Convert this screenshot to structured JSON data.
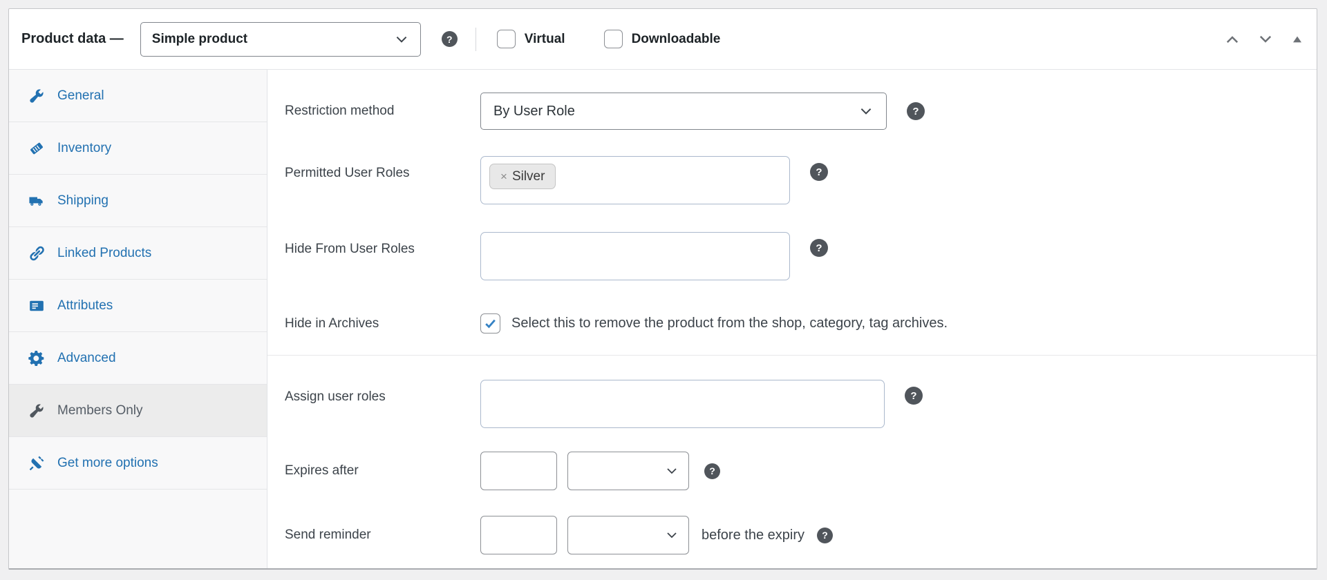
{
  "header": {
    "title": "Product data —",
    "product_type": "Simple product",
    "virtual_label": "Virtual",
    "downloadable_label": "Downloadable"
  },
  "sidebar": {
    "active_item": "Members Only",
    "items": [
      {
        "label": "General",
        "icon": "wrench-icon"
      },
      {
        "label": "Inventory",
        "icon": "tag-icon"
      },
      {
        "label": "Shipping",
        "icon": "truck-icon"
      },
      {
        "label": "Linked Products",
        "icon": "link-icon"
      },
      {
        "label": "Attributes",
        "icon": "list-card-icon"
      },
      {
        "label": "Advanced",
        "icon": "gear-icon"
      },
      {
        "label": "Members Only",
        "icon": "wrench-icon"
      },
      {
        "label": "Get more options",
        "icon": "plug-icon"
      }
    ]
  },
  "panel": {
    "restriction_method": {
      "label": "Restriction method",
      "value": "By User Role"
    },
    "permitted_user_roles": {
      "label": "Permitted User Roles",
      "tags": [
        "Silver"
      ],
      "remove_glyph": "×"
    },
    "hide_from_user_roles": {
      "label": "Hide From User Roles",
      "value": ""
    },
    "hide_in_archives": {
      "label": "Hide in Archives",
      "checked": true,
      "description": "Select this to remove the product from the shop, category, tag archives."
    },
    "assign_user_roles": {
      "label": "Assign user roles",
      "value": ""
    },
    "expires_after": {
      "label": "Expires after",
      "amount": "",
      "unit": ""
    },
    "send_reminder": {
      "label": "Send reminder",
      "amount": "",
      "unit": "",
      "suffix": "before the expiry"
    }
  },
  "glyphs": {
    "help": "?"
  },
  "colors": {
    "link_blue": "#2271b1",
    "check_blue": "#3582c4",
    "active_tab_bg": "#ececec",
    "page_bg": "#f0f0f1"
  }
}
